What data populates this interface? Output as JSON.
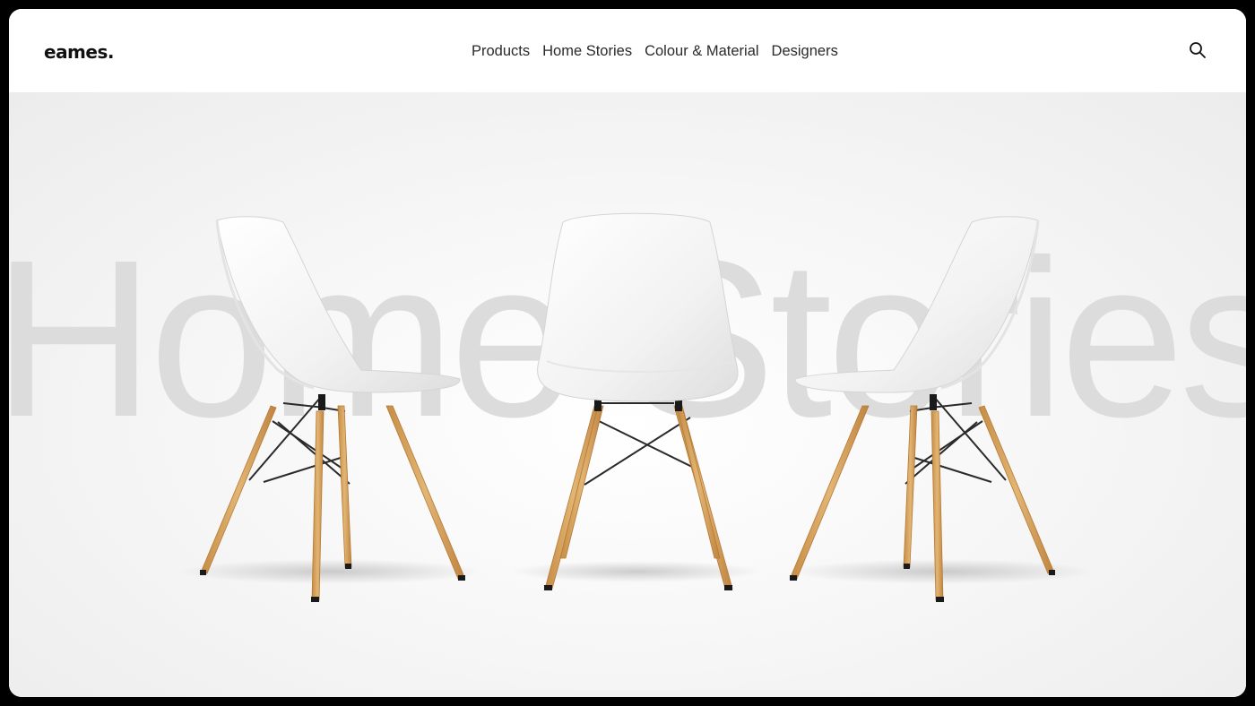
{
  "brand": {
    "logo": "eames."
  },
  "nav": {
    "items": [
      {
        "label": "Products"
      },
      {
        "label": "Home Stories"
      },
      {
        "label": "Colour & Material"
      },
      {
        "label": "Designers"
      }
    ]
  },
  "header": {
    "search_icon": "search-icon"
  },
  "hero": {
    "background_word": "Home Stories",
    "product": "Eames Plastic Side Chair DSW (white seat, maple legs)",
    "colors": {
      "shell": "#f4f4f4",
      "wood": "#d7a25a",
      "wire": "#2a2a2a",
      "text_watermark": "#dcdcdc"
    }
  }
}
